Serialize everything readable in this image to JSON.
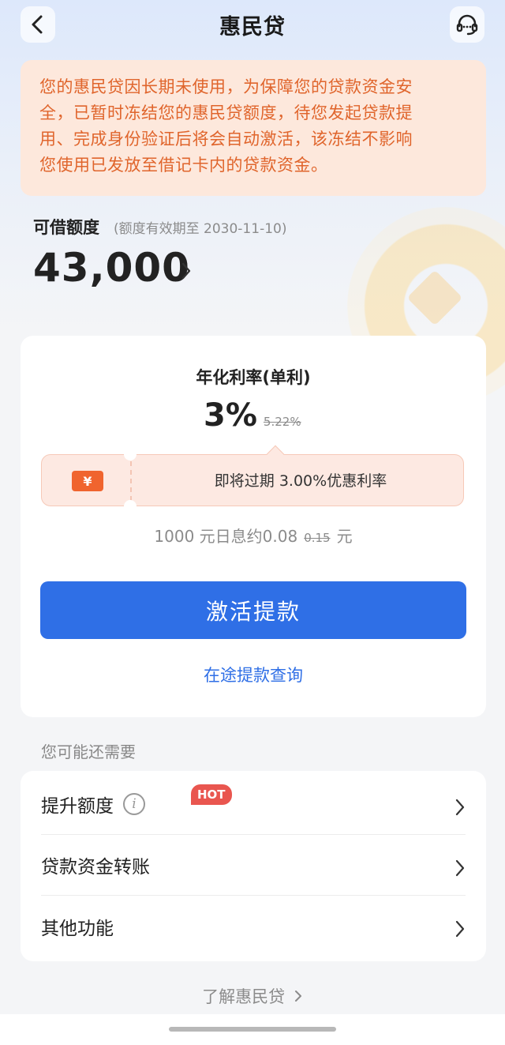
{
  "header": {
    "title": "惠民贷"
  },
  "notice": {
    "lines": [
      "您的惠民贷因长期未使用，为保障您的贷款资金安",
      "全，已暂时冻结您的惠民贷额度，待您发起贷款提",
      "用、完成身份验证后将会自动激活，该冻结不影响",
      "您使用已发放至借记卡内的贷款资金。"
    ]
  },
  "credit": {
    "label": "可借额度",
    "validity": "(额度有效期至 2030-11-10)",
    "amount": "43,000"
  },
  "rate": {
    "label": "年化利率(单利)",
    "value": "3%",
    "original": "5.22%"
  },
  "coupon": {
    "icon_symbol": "¥",
    "text": "即将过期 3.00%优惠利率"
  },
  "interest": {
    "prefix": "1000 元日息约0.08",
    "original": "0.15",
    "unit": "元"
  },
  "actions": {
    "activate_label": "激活提款",
    "query_label": "在途提款查询"
  },
  "more": {
    "heading": "您可能还需要",
    "items": [
      {
        "label": "提升额度",
        "badge": "HOT",
        "info_symbol": "i"
      },
      {
        "label": "贷款资金转账"
      },
      {
        "label": "其他功能"
      }
    ],
    "learn_more": "了解惠民贷"
  },
  "colors": {
    "accent": "#2f6fe6",
    "notice_text": "#e0652c",
    "hot": "#e9564f"
  }
}
